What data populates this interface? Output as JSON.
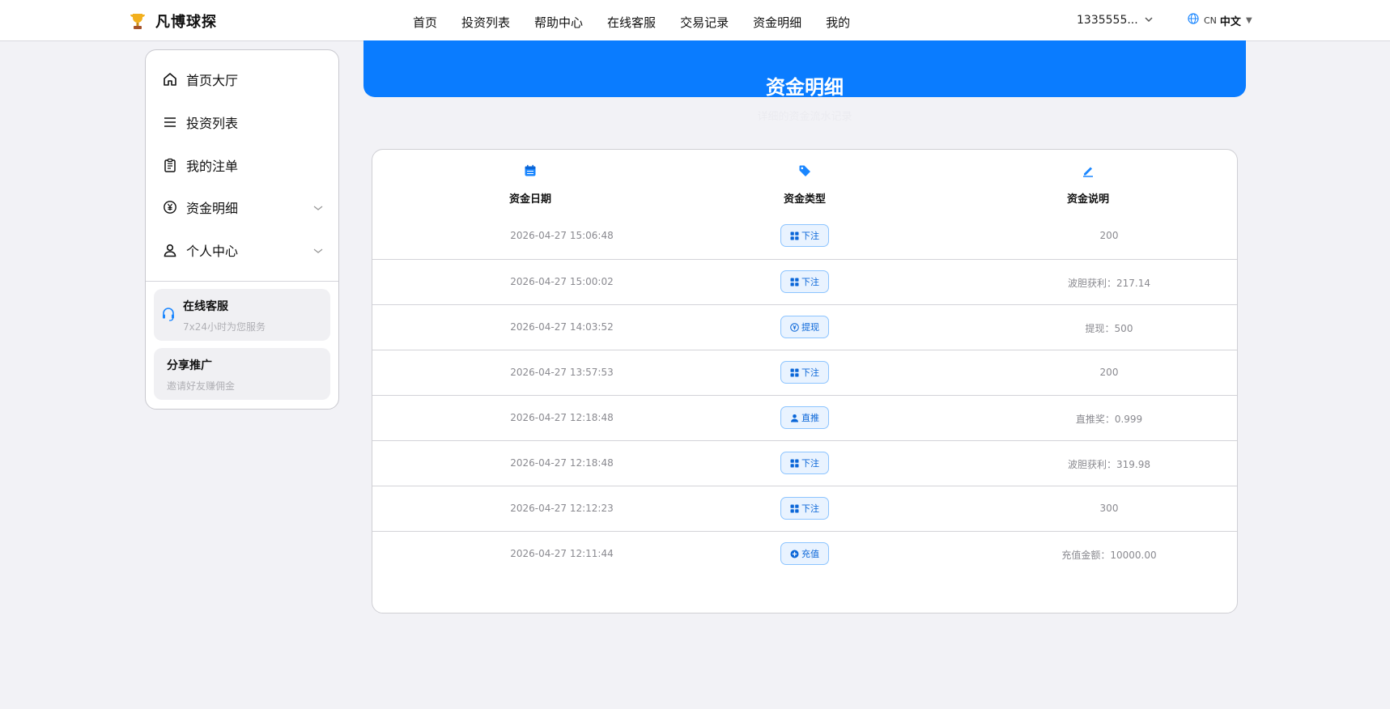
{
  "brand": {
    "name": "凡博球探",
    "logo_icon": "trophy-icon"
  },
  "nav": {
    "items": [
      "首页",
      "投资列表",
      "帮助中心",
      "在线客服",
      "交易记录",
      "资金明细",
      "我的"
    ]
  },
  "user": {
    "account": "1335555...",
    "dropdown_icon": "chevron-down-icon"
  },
  "language": {
    "code": "CN",
    "label": "中文",
    "icon": "globe-icon"
  },
  "sidebar": {
    "items": [
      {
        "label": "首页大厅",
        "icon": "home-icon",
        "expandable": false
      },
      {
        "label": "投资列表",
        "icon": "menu-icon",
        "expandable": false
      },
      {
        "label": "我的注单",
        "icon": "clipboard-icon",
        "expandable": false
      },
      {
        "label": "资金明细",
        "icon": "yuan-circle-icon",
        "expandable": true
      },
      {
        "label": "个人中心",
        "icon": "user-icon",
        "expandable": true
      }
    ],
    "support": {
      "title": "在线客服",
      "subtitle": "7x24小时为您服务",
      "icon": "headset-icon"
    },
    "share": {
      "title": "分享推广",
      "subtitle": "邀请好友赚佣金"
    }
  },
  "banner": {
    "title": "资金明细",
    "subtitle": "详细的资金流水记录"
  },
  "table": {
    "headers": [
      {
        "label": "资金日期",
        "icon": "calendar-icon"
      },
      {
        "label": "资金类型",
        "icon": "tag-icon"
      },
      {
        "label": "资金说明",
        "icon": "edit-icon"
      }
    ],
    "rows": [
      {
        "date": "2026-04-27 15:06:48",
        "type": "下注",
        "type_icon": "grid-icon",
        "desc": "200"
      },
      {
        "date": "2026-04-27 15:00:02",
        "type": "下注",
        "type_icon": "grid-icon",
        "desc": "波胆获利：217.14"
      },
      {
        "date": "2026-04-27 14:03:52",
        "type": "提现",
        "type_icon": "yuan-circle-icon",
        "desc": "提现：500"
      },
      {
        "date": "2026-04-27 13:57:53",
        "type": "下注",
        "type_icon": "grid-icon",
        "desc": "200"
      },
      {
        "date": "2026-04-27 12:18:48",
        "type": "直推",
        "type_icon": "user-icon",
        "desc": "直推奖：0.999"
      },
      {
        "date": "2026-04-27 12:18:48",
        "type": "下注",
        "type_icon": "grid-icon",
        "desc": "波胆获利：319.98"
      },
      {
        "date": "2026-04-27 12:12:23",
        "type": "下注",
        "type_icon": "grid-icon",
        "desc": "300"
      },
      {
        "date": "2026-04-27 12:11:44",
        "type": "充值",
        "type_icon": "plus-circle-icon",
        "desc": "充值金额：10000.00"
      }
    ]
  },
  "colors": {
    "accent": "#0a7cff",
    "tag_bg": "#e9f3ff",
    "tag_border": "#8cc4ff",
    "page_bg": "#f2f2f6"
  }
}
